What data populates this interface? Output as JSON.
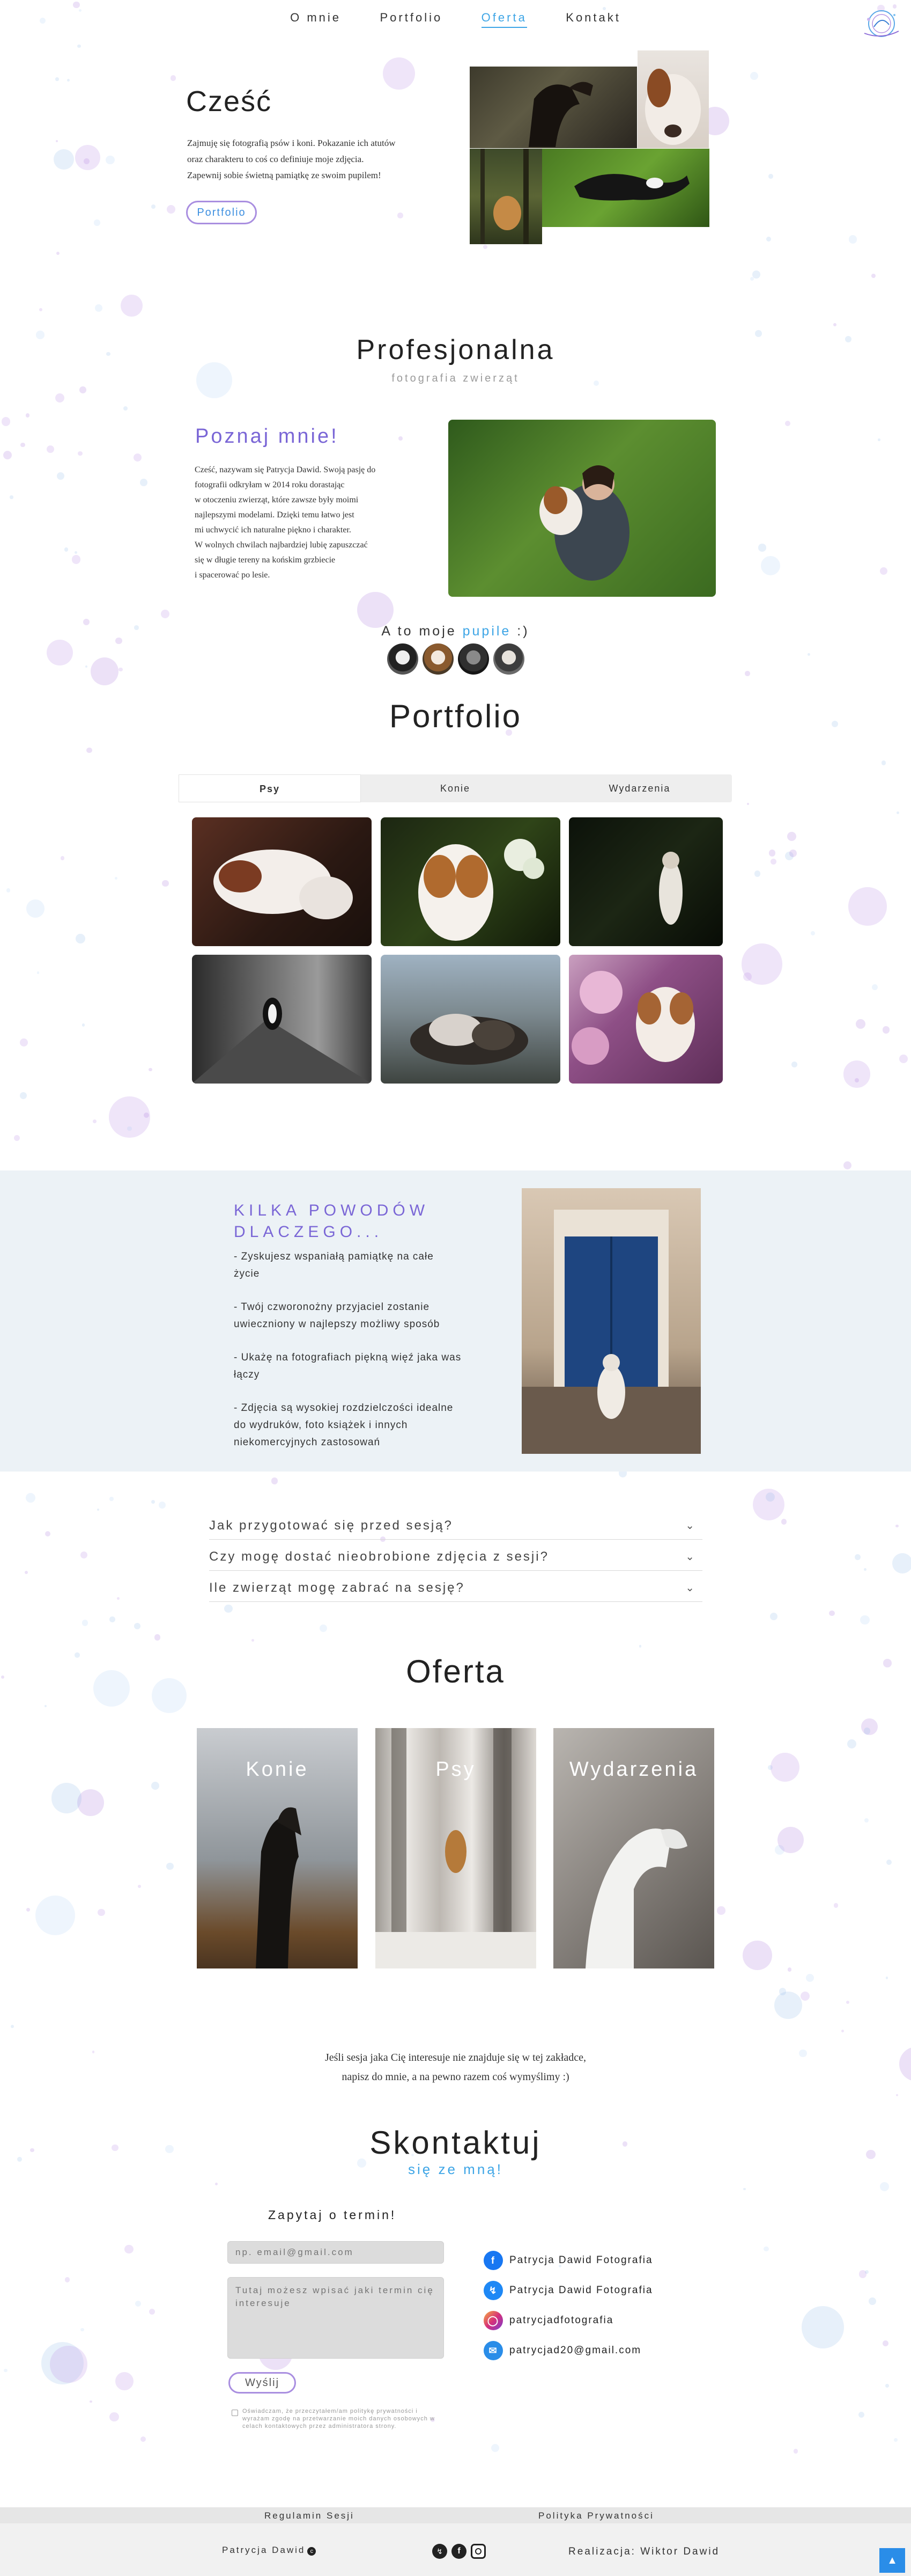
{
  "nav": {
    "items": [
      "O mnie",
      "Portfolio",
      "Oferta",
      "Kontakt"
    ],
    "active_index": 2
  },
  "hero": {
    "title": "Cześć",
    "text": [
      "Zajmuję się fotografią psów i koni. Pokazanie ich atutów",
      "oraz charakteru to coś co definiuje moje zdjęcia.",
      "Zapewnij sobie świetną pamiątkę ze swoim pupilem!"
    ],
    "button": "Portfolio"
  },
  "about_header": {
    "title": "Profesjonalna",
    "subtitle": "fotografia zwierząt"
  },
  "about": {
    "title": "Poznaj mnie!",
    "text": [
      "Cześć, nazywam się Patrycja Dawid. Swoją pasję do",
      "fotografii odkryłam w 2014 roku dorastając",
      "w otoczeniu zwierząt, które zawsze były moimi",
      "najlepszymi modelami. Dzięki temu łatwo jest",
      "mi uchwycić ich naturalne piękno i charakter.",
      "W wolnych chwilach najbardziej lubię zapuszczać",
      "się w długie tereny na końskim grzbiecie",
      "i spacerować po lesie."
    ],
    "pets_prefix": "A to moje",
    "pets_word": "pupile",
    "pets_suffix": ":)"
  },
  "portfolio": {
    "title": "Portfolio",
    "tabs": [
      "Psy",
      "Konie",
      "Wydarzenia"
    ],
    "active_tab": 0
  },
  "reasons": {
    "title_line1": "KILKA POWODÓW",
    "title_line2": "DLACZEGO...",
    "items": [
      [
        "- Zyskujesz wspaniałą pamiątkę na całe",
        "życie"
      ],
      [
        "- Twój czworonożny przyjaciel zostanie",
        "uwieczniony w najlepszy możliwy sposób"
      ],
      [
        "- Ukażę na fotografiach piękną więź jaka was",
        "łączy"
      ],
      [
        "- Zdjęcia są wysokiej rozdzielczości idealne",
        "do wydruków, foto książek i innych",
        "niekomercyjnych zastosowań"
      ]
    ]
  },
  "faq": [
    "Jak przygotować się przed sesją?",
    "Czy mogę dostać nieobrobione zdjęcia z sesji?",
    "Ile zwierząt mogę zabrać na sesję?"
  ],
  "offer": {
    "title": "Oferta",
    "cards": [
      "Konie",
      "Psy",
      "Wydarzenia"
    ],
    "note_line1": "Jeśli sesja jaka Cię interesuje nie znajduje się w tej zakładce,",
    "note_line2": "napisz do mnie, a na pewno razem coś wymyślimy :)"
  },
  "contact": {
    "title": "Skontaktuj",
    "subtitle": "się ze mną!",
    "form_title": "Zapytaj o termin!",
    "email_placeholder": "np. email@gmail.com",
    "message_placeholder": "Tutaj możesz wpisać jaki termin cię interesuje",
    "send": "Wyślij",
    "consent": "Oświadczam, że przeczytałem/am politykę prywatności i wyrażam zgodę na przetwarzanie moich danych osobowych w celach kontaktowych przez administratora strony.",
    "links": [
      {
        "icon": "facebook-icon",
        "label": "Patrycja Dawid Fotografia",
        "color": "#1877f2"
      },
      {
        "icon": "messenger-icon",
        "label": "Patrycja Dawid Fotografia",
        "color": "#1e88f5"
      },
      {
        "icon": "instagram-icon",
        "label": "patrycjadfotografia",
        "color": "#d6307a"
      },
      {
        "icon": "mail-icon",
        "label": "patrycjad20@gmail.com",
        "color": "#2a8de8"
      }
    ]
  },
  "footer": {
    "terms": "Regulamin Sesji",
    "privacy": "Polityka Prywatności",
    "brand": "Patrycja Dawid",
    "credit": "Realizacja: Wiktor Dawid"
  },
  "colors": {
    "accent_blue": "#3da5e6",
    "accent_purple": "#8e6bd6",
    "reasons_bg": "#ecf2f6"
  }
}
